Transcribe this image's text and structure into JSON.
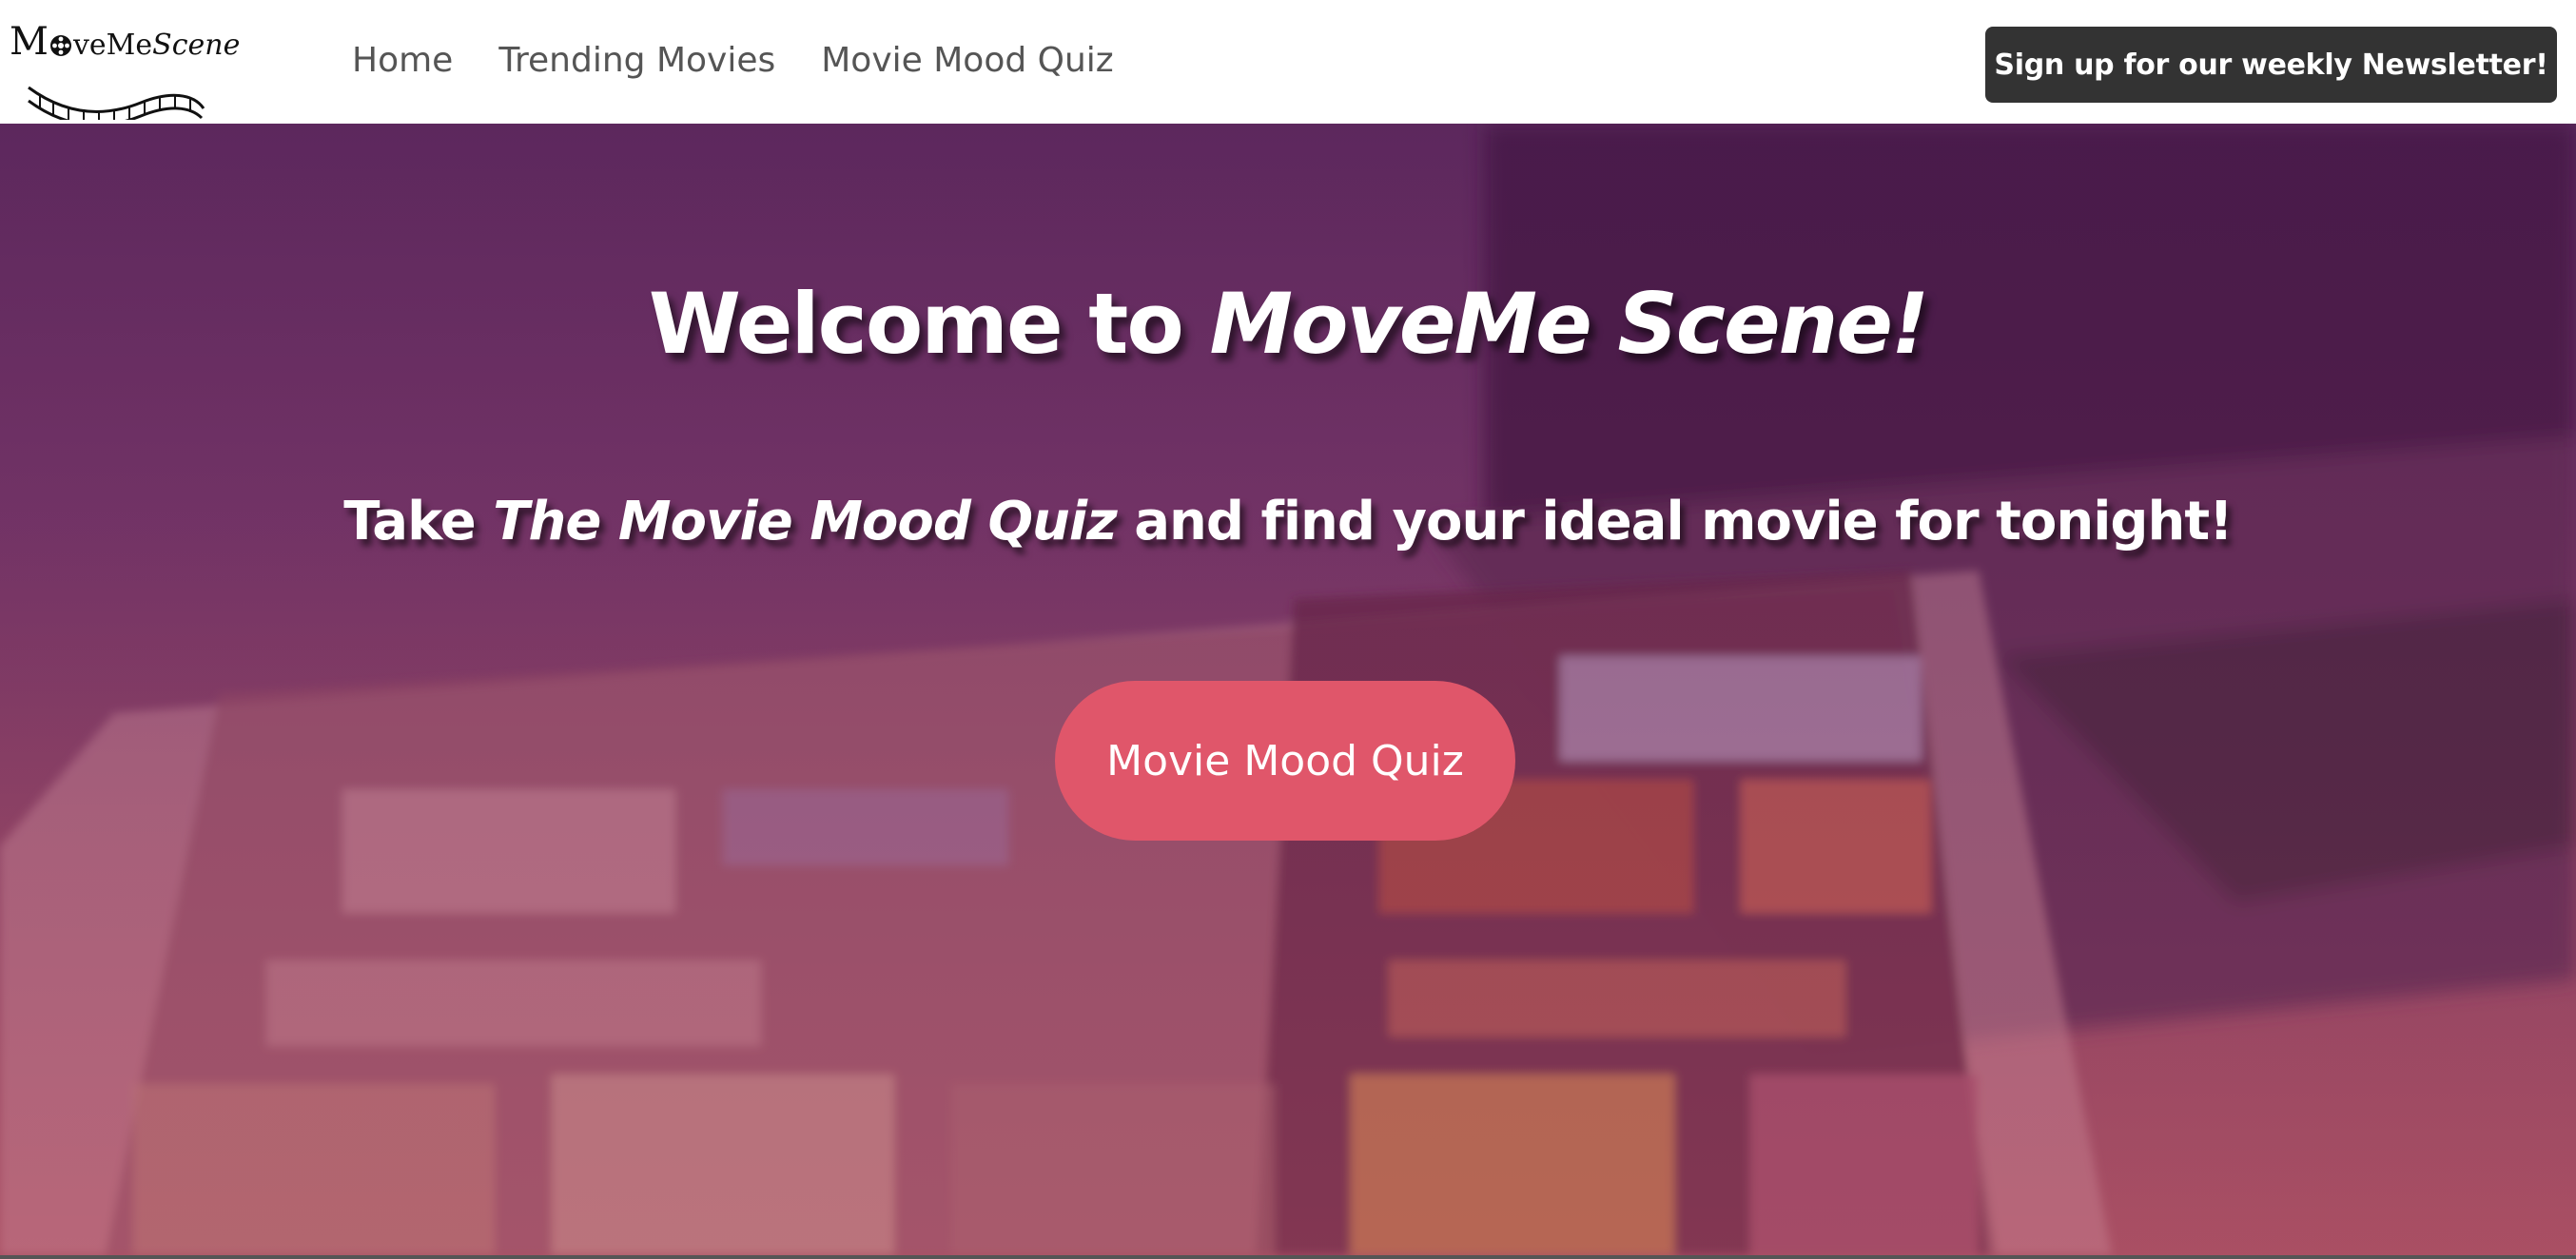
{
  "logo": {
    "text_m": "M",
    "text_rest": "veMe",
    "text_scene": "Scene"
  },
  "nav": {
    "items": [
      {
        "label": "Home"
      },
      {
        "label": "Trending Movies"
      },
      {
        "label": "Movie Mood Quiz"
      }
    ],
    "newsletter_label": "Sign up for our weekly Newsletter!"
  },
  "hero": {
    "title_prefix": "Welcome to ",
    "title_brand": "MoveMe Scene!",
    "subtitle_prefix": "Take ",
    "subtitle_quiz": "The Movie Mood Quiz",
    "subtitle_suffix": " and find your ideal movie for tonight!",
    "cta_label": "Movie Mood Quiz"
  },
  "colors": {
    "nav_text": "#555555",
    "newsletter_bg": "#333333",
    "cta_bg": "#e0566a",
    "hero_tint": "#6e3467"
  }
}
